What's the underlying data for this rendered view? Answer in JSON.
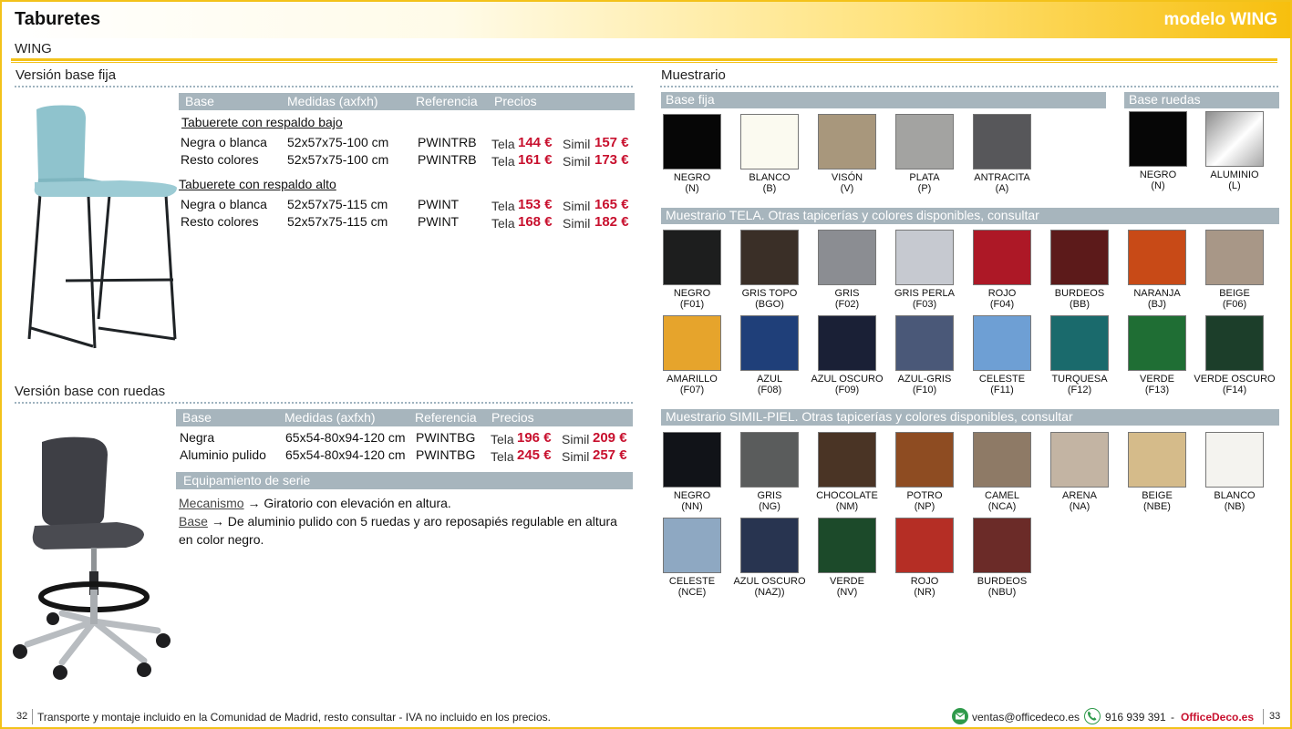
{
  "header": {
    "title": "Taburetes",
    "model": "modelo WING",
    "subtitle": "WING"
  },
  "fixed": {
    "title": "Versión base fija",
    "headers": [
      "Base",
      "Medidas (axfxh)",
      "Referencia",
      "Precios"
    ],
    "groups": [
      {
        "subtitle": "Tabuerete con respaldo bajo",
        "rows": [
          {
            "base": "Negra o blanca",
            "medidas": "52x57x75-100 cm",
            "ref": "PWINTRB",
            "tela_label": "Tela",
            "tela": "144 €",
            "simil_label": "Simil",
            "simil": "157 €"
          },
          {
            "base": "Resto colores",
            "medidas": "52x57x75-100 cm",
            "ref": "PWINTRB",
            "tela_label": "Tela",
            "tela": "161 €",
            "simil_label": "Simil",
            "simil": "173 €"
          }
        ]
      },
      {
        "subtitle": "Tabuerete con respaldo alto",
        "rows": [
          {
            "base": "Negra o blanca",
            "medidas": "52x57x75-115 cm",
            "ref": "PWINT",
            "tela_label": "Tela",
            "tela": "153 €",
            "simil_label": "Simil",
            "simil": "165 €"
          },
          {
            "base": "Resto colores",
            "medidas": "52x57x75-115 cm",
            "ref": "PWINT",
            "tela_label": "Tela",
            "tela": "168 €",
            "simil_label": "Simil",
            "simil": "182 €"
          }
        ]
      }
    ]
  },
  "wheels": {
    "title": "Versión base con ruedas",
    "headers": [
      "Base",
      "Medidas (axfxh)",
      "Referencia",
      "Precios"
    ],
    "rows": [
      {
        "base": "Negra",
        "medidas": "65x54-80x94-120 cm",
        "ref": "PWINTBG",
        "tela_label": "Tela",
        "tela": "196 €",
        "simil_label": "Simil",
        "simil": "209 €"
      },
      {
        "base": "Aluminio pulido",
        "medidas": "65x54-80x94-120 cm",
        "ref": "PWINTBG",
        "tela_label": "Tela",
        "tela": "245 €",
        "simil_label": "Simil",
        "simil": "257 €"
      }
    ],
    "equip_title": "Equipamiento de serie",
    "equip": [
      {
        "term": "Mecanismo",
        "arrow": "→",
        "text": "Giratorio con elevación en altura."
      },
      {
        "term": "Base",
        "arrow": "→",
        "text": "De aluminio pulido con 5 ruedas y aro reposapiés regulable en altura"
      },
      {
        "term": "",
        "arrow": "",
        "text": "en color negro."
      }
    ]
  },
  "muestrario": {
    "title": "Muestrario",
    "base_fija": {
      "label": "Base fija",
      "swatches": [
        {
          "name": "NEGRO",
          "code": "(N)",
          "color": "#060606"
        },
        {
          "name": "BLANCO",
          "code": "(B)",
          "color": "#fbfaf0"
        },
        {
          "name": "VISÓN",
          "code": "(V)",
          "color": "#a8977c"
        },
        {
          "name": "PLATA",
          "code": "(P)",
          "color": "#a3a3a1"
        },
        {
          "name": "ANTRACITA",
          "code": "(A)",
          "color": "#57575a"
        }
      ]
    },
    "base_ruedas": {
      "label": "Base ruedas",
      "swatches": [
        {
          "name": "NEGRO",
          "code": "(N)",
          "color": "#060606"
        },
        {
          "name": "ALUMINIO",
          "code": "(L)",
          "color": "#c9c9c9"
        }
      ]
    },
    "tela": {
      "label": "Muestrario TELA. Otras tapicerías y colores disponibles, consultar",
      "swatches": [
        {
          "name": "NEGRO",
          "code": "(F01)",
          "color": "#1d1e1e"
        },
        {
          "name": "GRIS TOPO",
          "code": "(BGO)",
          "color": "#3a2f27"
        },
        {
          "name": "GRIS",
          "code": "(F02)",
          "color": "#8b8d92"
        },
        {
          "name": "GRIS PERLA",
          "code": "(F03)",
          "color": "#c6c9d0"
        },
        {
          "name": "ROJO",
          "code": "(F04)",
          "color": "#ad1826"
        },
        {
          "name": "BURDEOS",
          "code": "(BB)",
          "color": "#5c1a1a"
        },
        {
          "name": "NARANJA",
          "code": "(BJ)",
          "color": "#c84a17"
        },
        {
          "name": "BEIGE",
          "code": "(F06)",
          "color": "#a89787"
        },
        {
          "name": "AMARILLO",
          "code": "(F07)",
          "color": "#e6a42c"
        },
        {
          "name": "AZUL",
          "code": "(F08)",
          "color": "#1f3f79"
        },
        {
          "name": "AZUL OSCURO",
          "code": "(F09)",
          "color": "#1a2036"
        },
        {
          "name": "AZUL-GRIS",
          "code": "(F10)",
          "color": "#4a5878"
        },
        {
          "name": "CELESTE",
          "code": "(F11)",
          "color": "#6e9fd4"
        },
        {
          "name": "TURQUESA",
          "code": "(F12)",
          "color": "#1a6a6c"
        },
        {
          "name": "VERDE",
          "code": "(F13)",
          "color": "#1f6e34"
        },
        {
          "name": "VERDE OSCURO",
          "code": "(F14)",
          "color": "#1c3e2a"
        }
      ]
    },
    "simil": {
      "label": "Muestrario SIMIL-PIEL. Otras tapicerías y colores disponibles, consultar",
      "swatches": [
        {
          "name": "NEGRO",
          "code": "(NN)",
          "color": "#111318"
        },
        {
          "name": "GRIS",
          "code": "(NG)",
          "color": "#5a5c5c"
        },
        {
          "name": "CHOCOLATE",
          "code": "(NM)",
          "color": "#4a3425"
        },
        {
          "name": "POTRO",
          "code": "(NP)",
          "color": "#8e4c22"
        },
        {
          "name": "CAMEL",
          "code": "(NCA)",
          "color": "#8e7a66"
        },
        {
          "name": "ARENA",
          "code": "(NA)",
          "color": "#c3b4a3"
        },
        {
          "name": "BEIGE",
          "code": "(NBE)",
          "color": "#d5bb8a"
        },
        {
          "name": "BLANCO",
          "code": "(NB)",
          "color": "#f4f3ef"
        },
        {
          "name": "CELESTE",
          "code": "(NCE)",
          "color": "#8ea8c2"
        },
        {
          "name": "AZUL OSCURO",
          "code": "(NAZ))",
          "color": "#283450"
        },
        {
          "name": "VERDE",
          "code": "(NV)",
          "color": "#1c4a2a"
        },
        {
          "name": "ROJO",
          "code": "(NR)",
          "color": "#b52e25"
        },
        {
          "name": "BURDEOS",
          "code": "(NBU)",
          "color": "#6b2b28"
        }
      ]
    }
  },
  "footer": {
    "page_left": "32",
    "note": "Transporte y montaje incluido en la Comunidad de Madrid, resto consultar - IVA no incluido en los precios.",
    "email": "ventas@officedeco.es",
    "phone": "916 939 391",
    "sep": "-",
    "brand": "OfficeDeco.es",
    "page_right": "33"
  },
  "colors": {
    "accent": "#f3c21a",
    "band": "#a7b5bd",
    "price": "#c8102e"
  },
  "icons": {
    "email": "envelope-icon",
    "phone": "phone-icon"
  }
}
